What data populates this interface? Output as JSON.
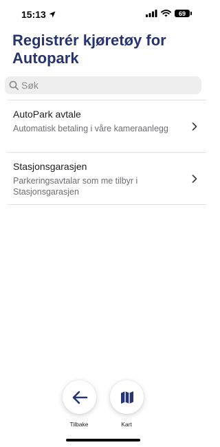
{
  "status_bar": {
    "time": "15:13",
    "battery": "69"
  },
  "page": {
    "title": "Registrér kjøretøy for Autopark"
  },
  "search": {
    "placeholder": "Søk"
  },
  "items": [
    {
      "title": "AutoPark avtale",
      "description": "Automatisk betaling i våre kameraanlegg"
    },
    {
      "title": "Stasjonsgarasjen",
      "description": "Parkeringsavtalar som me tilbyr i Stasjonsgarasjen"
    }
  ],
  "bottom_nav": {
    "back_label": "Tilbake",
    "map_label": "Kart"
  },
  "colors": {
    "brand": "#26356f",
    "search_bg": "#eeeeef",
    "divider": "#e3e3e6"
  }
}
